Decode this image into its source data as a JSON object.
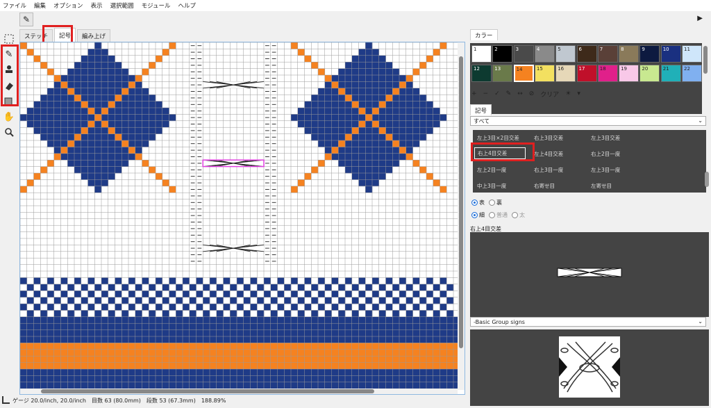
{
  "menu": [
    "ファイル",
    "編集",
    "オプション",
    "表示",
    "選択範囲",
    "モジュール",
    "ヘルプ"
  ],
  "icons": {
    "pencil": "pencil-icon",
    "stamp": "stamp-icon",
    "eraser": "eraser-icon",
    "hand": "hand-icon",
    "zoom": "magnifier-icon",
    "select": "dashed-select-icon"
  },
  "tabs": [
    "ステッチ",
    "記号",
    "編み上げ"
  ],
  "active_tab": "記号",
  "status": {
    "gauge": "ゲージ 20.0/inch, 20.0/inch",
    "stitches": "目数 63 (80.0mm)",
    "rows": "段数 53 (67.3mm)",
    "zoom": "188.89%"
  },
  "colors": {
    "navy": "#1f3b87",
    "orange": "#f58220",
    "grid": "#9a9a9a",
    "highlight": "#e02020",
    "accent": "#1e6fd9"
  },
  "panel": {
    "color_tab": "カラー",
    "swatches": [
      {
        "n": "1",
        "c": "#ffffff"
      },
      {
        "n": "2",
        "c": "#000000"
      },
      {
        "n": "3",
        "c": "#4a4a4a"
      },
      {
        "n": "4",
        "c": "#8a8a8a"
      },
      {
        "n": "5",
        "c": "#c0c8d0"
      },
      {
        "n": "6",
        "c": "#3e2a1a"
      },
      {
        "n": "7",
        "c": "#5a4038"
      },
      {
        "n": "8",
        "c": "#8a7a5a"
      },
      {
        "n": "9",
        "c": "#0d1a40"
      },
      {
        "n": "10",
        "c": "#1a3080"
      },
      {
        "n": "11",
        "c": "#cfe6fa"
      },
      {
        "n": "12",
        "c": "#0d3a30"
      },
      {
        "n": "13",
        "c": "#6a7a4a"
      },
      {
        "n": "14",
        "c": "#f58220"
      },
      {
        "n": "15",
        "c": "#f3e060"
      },
      {
        "n": "16",
        "c": "#e6d8b8"
      },
      {
        "n": "17",
        "c": "#c0102a"
      },
      {
        "n": "18",
        "c": "#e0208a"
      },
      {
        "n": "19",
        "c": "#f8c8e8"
      },
      {
        "n": "20",
        "c": "#c8e890"
      },
      {
        "n": "21",
        "c": "#20b0b8"
      },
      {
        "n": "22",
        "c": "#80b0f0"
      }
    ],
    "palette_tools": [
      "+",
      "−",
      "✓",
      "✎",
      "↔",
      "⊘",
      "クリア",
      "☀",
      "▾"
    ],
    "symbol_tab": "記号",
    "symbol_filter": "すべて",
    "symbols": [
      [
        "左上3目×2目交差",
        "右上3目交差",
        "左上3目交差"
      ],
      [
        "右上4目交差",
        "左上4目交差",
        "右上2目一度"
      ],
      [
        "左上2目一度",
        "右上3目一度",
        "左上3目一度"
      ],
      [
        "中上3目一度",
        "右寄せ目",
        "左寄せ目"
      ]
    ],
    "radio1": [
      "表",
      "裏"
    ],
    "radio2": [
      "細",
      "普通",
      "太"
    ],
    "preview_title": "右上4目交差",
    "group_select": "-Basic Group signs"
  }
}
